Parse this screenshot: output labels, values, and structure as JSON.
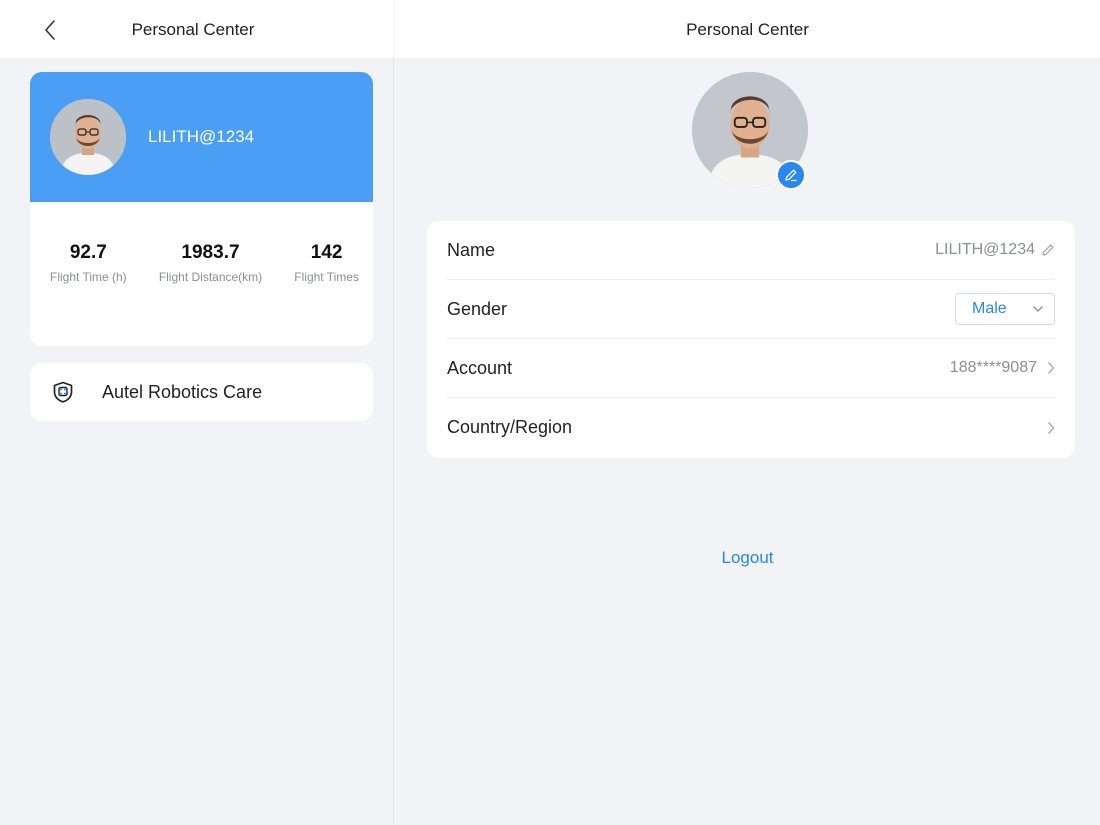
{
  "left_panel": {
    "header_title": "Personal Center",
    "profile": {
      "username": "LILITH@1234",
      "banner_color": "#4a9ff5",
      "stats": [
        {
          "value": "92.7",
          "label": "Flight Time (h)"
        },
        {
          "value": "1983.7",
          "label": "Flight Distance(km)"
        },
        {
          "value": "142",
          "label": "Flight Times"
        }
      ]
    },
    "care_item": {
      "label": "Autel Robotics Care",
      "icon": "shield-icon"
    }
  },
  "right_panel": {
    "header_title": "Personal Center",
    "rows": {
      "name": {
        "label": "Name",
        "value": "LILITH@1234"
      },
      "gender": {
        "label": "Gender",
        "value": "Male"
      },
      "account": {
        "label": "Account",
        "value": "188****9087"
      },
      "country": {
        "label": "Country/Region",
        "value": ""
      }
    },
    "logout_label": "Logout",
    "accent_color": "#2a86f0"
  }
}
